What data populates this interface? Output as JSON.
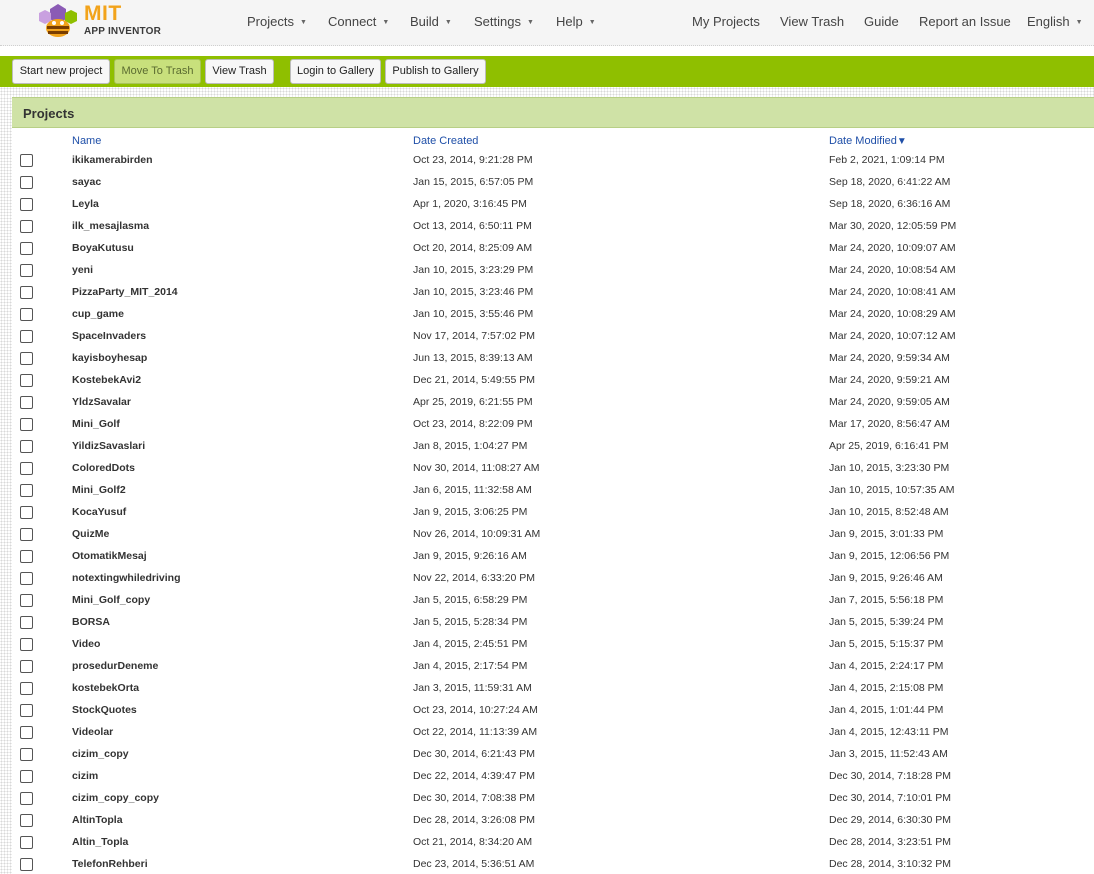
{
  "logo": {
    "title": "MIT",
    "subtitle": "APP INVENTOR"
  },
  "nav": {
    "menus": [
      "Projects",
      "Connect",
      "Build",
      "Settings",
      "Help"
    ],
    "links": [
      "My Projects",
      "View Trash",
      "Guide",
      "Report an Issue",
      "English"
    ]
  },
  "toolbar": {
    "start_new_project": "Start new project",
    "move_to_trash": "Move To Trash",
    "view_trash": "View Trash",
    "login_to_gallery": "Login to Gallery",
    "publish_to_gallery": "Publish to Gallery"
  },
  "panel": {
    "title": "Projects"
  },
  "columns": {
    "name": "Name",
    "created": "Date Created",
    "modified": "Date Modified",
    "sort_indicator": "▼"
  },
  "projects": [
    {
      "name": "ikikamerabirden",
      "created": "Oct 23, 2014, 9:21:28 PM",
      "modified": "Feb 2, 2021, 1:09:14 PM"
    },
    {
      "name": "sayac",
      "created": "Jan 15, 2015, 6:57:05 PM",
      "modified": "Sep 18, 2020, 6:41:22 AM"
    },
    {
      "name": "Leyla",
      "created": "Apr 1, 2020, 3:16:45 PM",
      "modified": "Sep 18, 2020, 6:36:16 AM"
    },
    {
      "name": "ilk_mesajlasma",
      "created": "Oct 13, 2014, 6:50:11 PM",
      "modified": "Mar 30, 2020, 12:05:59 PM"
    },
    {
      "name": "BoyaKutusu",
      "created": "Oct 20, 2014, 8:25:09 AM",
      "modified": "Mar 24, 2020, 10:09:07 AM"
    },
    {
      "name": "yeni",
      "created": "Jan 10, 2015, 3:23:29 PM",
      "modified": "Mar 24, 2020, 10:08:54 AM"
    },
    {
      "name": "PizzaParty_MIT_2014",
      "created": "Jan 10, 2015, 3:23:46 PM",
      "modified": "Mar 24, 2020, 10:08:41 AM"
    },
    {
      "name": "cup_game",
      "created": "Jan 10, 2015, 3:55:46 PM",
      "modified": "Mar 24, 2020, 10:08:29 AM"
    },
    {
      "name": "SpaceInvaders",
      "created": "Nov 17, 2014, 7:57:02 PM",
      "modified": "Mar 24, 2020, 10:07:12 AM"
    },
    {
      "name": "kayisboyhesap",
      "created": "Jun 13, 2015, 8:39:13 AM",
      "modified": "Mar 24, 2020, 9:59:34 AM"
    },
    {
      "name": "KostebekAvi2",
      "created": "Dec 21, 2014, 5:49:55 PM",
      "modified": "Mar 24, 2020, 9:59:21 AM"
    },
    {
      "name": "YldzSavalar",
      "created": "Apr 25, 2019, 6:21:55 PM",
      "modified": "Mar 24, 2020, 9:59:05 AM"
    },
    {
      "name": "Mini_Golf",
      "created": "Oct 23, 2014, 8:22:09 PM",
      "modified": "Mar 17, 2020, 8:56:47 AM"
    },
    {
      "name": "YildizSavaslari",
      "created": "Jan 8, 2015, 1:04:27 PM",
      "modified": "Apr 25, 2019, 6:16:41 PM"
    },
    {
      "name": "ColoredDots",
      "created": "Nov 30, 2014, 11:08:27 AM",
      "modified": "Jan 10, 2015, 3:23:30 PM"
    },
    {
      "name": "Mini_Golf2",
      "created": "Jan 6, 2015, 11:32:58 AM",
      "modified": "Jan 10, 2015, 10:57:35 AM"
    },
    {
      "name": "KocaYusuf",
      "created": "Jan 9, 2015, 3:06:25 PM",
      "modified": "Jan 10, 2015, 8:52:48 AM"
    },
    {
      "name": "QuizMe",
      "created": "Nov 26, 2014, 10:09:31 AM",
      "modified": "Jan 9, 2015, 3:01:33 PM"
    },
    {
      "name": "OtomatikMesaj",
      "created": "Jan 9, 2015, 9:26:16 AM",
      "modified": "Jan 9, 2015, 12:06:56 PM"
    },
    {
      "name": "notextingwhiledriving",
      "created": "Nov 22, 2014, 6:33:20 PM",
      "modified": "Jan 9, 2015, 9:26:46 AM"
    },
    {
      "name": "Mini_Golf_copy",
      "created": "Jan 5, 2015, 6:58:29 PM",
      "modified": "Jan 7, 2015, 5:56:18 PM"
    },
    {
      "name": "BORSA",
      "created": "Jan 5, 2015, 5:28:34 PM",
      "modified": "Jan 5, 2015, 5:39:24 PM"
    },
    {
      "name": "Video",
      "created": "Jan 4, 2015, 2:45:51 PM",
      "modified": "Jan 5, 2015, 5:15:37 PM"
    },
    {
      "name": "prosedurDeneme",
      "created": "Jan 4, 2015, 2:17:54 PM",
      "modified": "Jan 4, 2015, 2:24:17 PM"
    },
    {
      "name": "kostebekOrta",
      "created": "Jan 3, 2015, 11:59:31 AM",
      "modified": "Jan 4, 2015, 2:15:08 PM"
    },
    {
      "name": "StockQuotes",
      "created": "Oct 23, 2014, 10:27:24 AM",
      "modified": "Jan 4, 2015, 1:01:44 PM"
    },
    {
      "name": "Videolar",
      "created": "Oct 22, 2014, 11:13:39 AM",
      "modified": "Jan 4, 2015, 12:43:11 PM"
    },
    {
      "name": "cizim_copy",
      "created": "Dec 30, 2014, 6:21:43 PM",
      "modified": "Jan 3, 2015, 11:52:43 AM"
    },
    {
      "name": "cizim",
      "created": "Dec 22, 2014, 4:39:47 PM",
      "modified": "Dec 30, 2014, 7:18:28 PM"
    },
    {
      "name": "cizim_copy_copy",
      "created": "Dec 30, 2014, 7:08:38 PM",
      "modified": "Dec 30, 2014, 7:10:01 PM"
    },
    {
      "name": "AltinTopla",
      "created": "Dec 28, 2014, 3:26:08 PM",
      "modified": "Dec 29, 2014, 6:30:30 PM"
    },
    {
      "name": "Altin_Topla",
      "created": "Oct 21, 2014, 8:34:20 AM",
      "modified": "Dec 28, 2014, 3:23:51 PM"
    },
    {
      "name": "TelefonRehberi",
      "created": "Dec 23, 2014, 5:36:51 AM",
      "modified": "Dec 28, 2014, 3:10:32 PM"
    }
  ]
}
